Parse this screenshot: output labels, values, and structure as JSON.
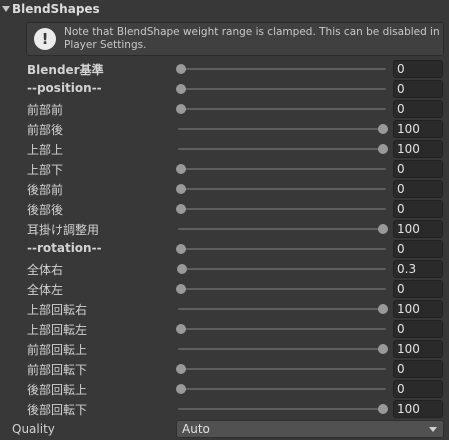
{
  "header": {
    "title": "BlendShapes"
  },
  "help": {
    "text": "Note that BlendShape weight range is clamped. This can be disabled in Player Settings."
  },
  "blendshapes": [
    {
      "label": "Blender基準",
      "value": "0",
      "level": 0,
      "bold": true
    },
    {
      "label": "--position--",
      "value": "0",
      "level": 0,
      "bold": true
    },
    {
      "label": "前部前",
      "value": "0",
      "level": 0,
      "bold": false
    },
    {
      "label": "前部後",
      "value": "100",
      "level": 100,
      "bold": false
    },
    {
      "label": "上部上",
      "value": "100",
      "level": 100,
      "bold": false
    },
    {
      "label": "上部下",
      "value": "0",
      "level": 0,
      "bold": false
    },
    {
      "label": "後部前",
      "value": "0",
      "level": 0,
      "bold": false
    },
    {
      "label": "後部後",
      "value": "0",
      "level": 0,
      "bold": false
    },
    {
      "label": "耳掛け調整用",
      "value": "100",
      "level": 100,
      "bold": false
    },
    {
      "label": "--rotation--",
      "value": "0",
      "level": 0,
      "bold": true
    },
    {
      "label": "全体右",
      "value": "0.3",
      "level": 0.3,
      "bold": false
    },
    {
      "label": "全体左",
      "value": "0",
      "level": 0,
      "bold": false
    },
    {
      "label": "上部回転右",
      "value": "100",
      "level": 100,
      "bold": false
    },
    {
      "label": "上部回転左",
      "value": "0",
      "level": 0,
      "bold": false
    },
    {
      "label": "前部回転上",
      "value": "100",
      "level": 100,
      "bold": false
    },
    {
      "label": "前部回転下",
      "value": "0",
      "level": 0,
      "bold": false
    },
    {
      "label": "後部回転上",
      "value": "0",
      "level": 0,
      "bold": false
    },
    {
      "label": "後部回転下",
      "value": "100",
      "level": 100,
      "bold": false
    }
  ],
  "quality": {
    "label": "Quality",
    "selected": "Auto"
  }
}
